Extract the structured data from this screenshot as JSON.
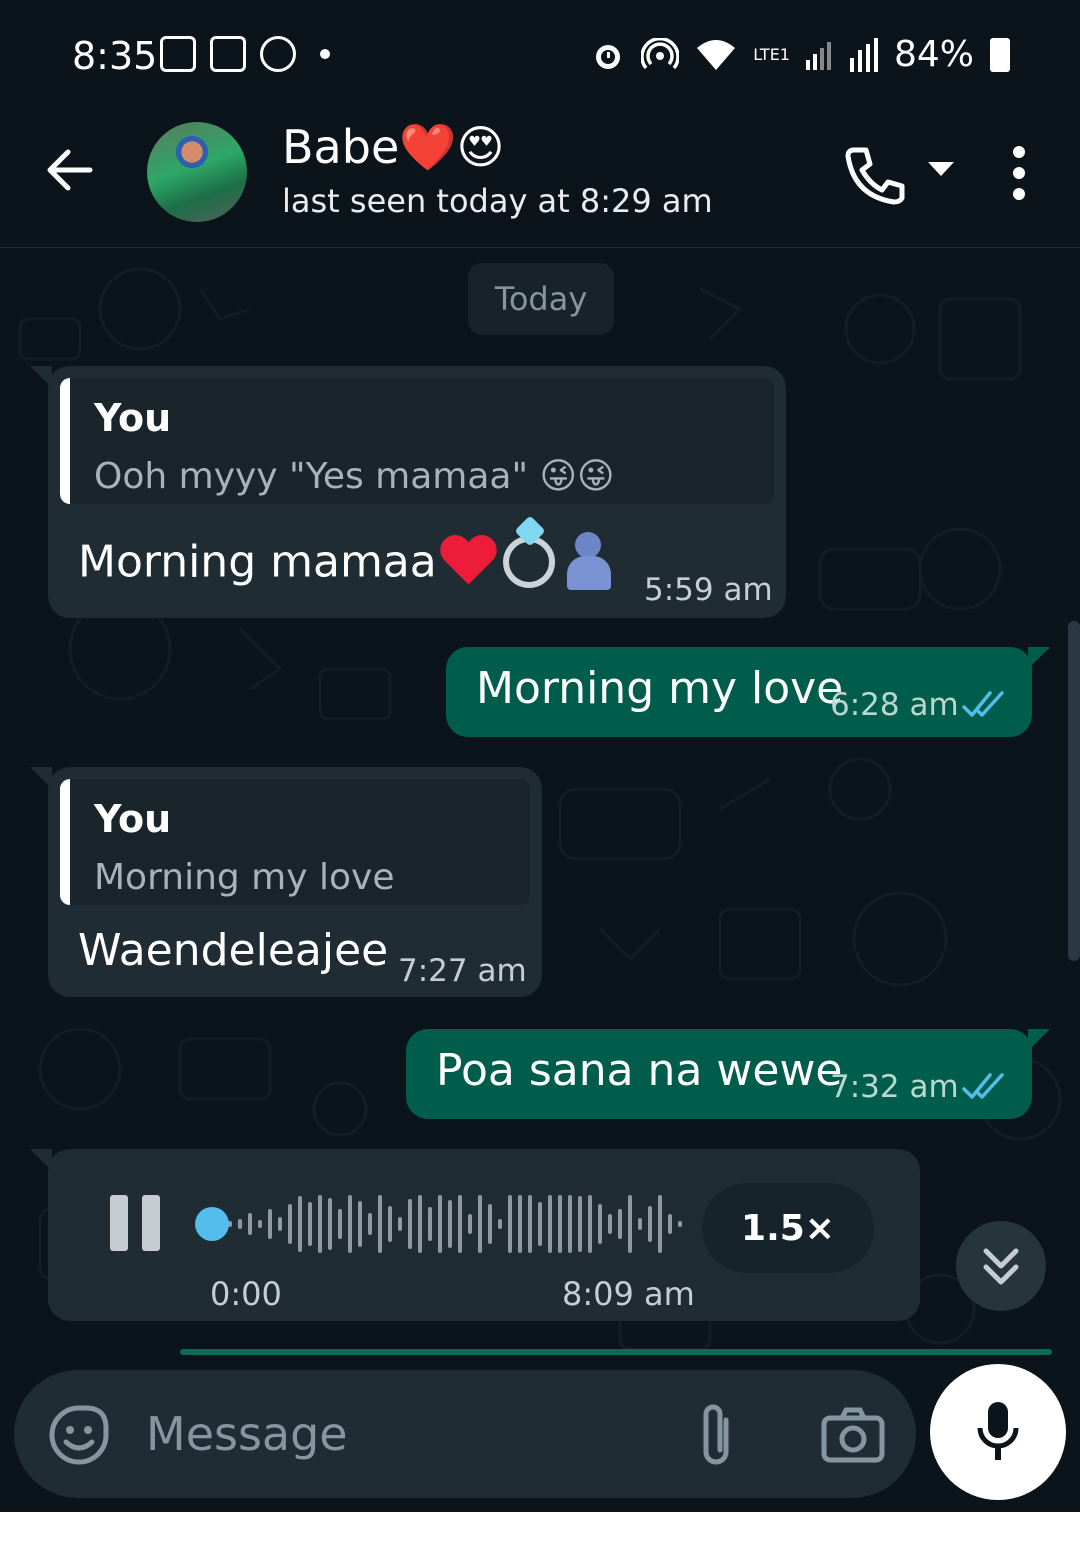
{
  "status_bar": {
    "time": "8:35",
    "battery": "84%",
    "network": "LTE1"
  },
  "header": {
    "contact_name": "Babe❤️😍",
    "last_seen": "last seen today at 8:29 am"
  },
  "date_chip": "Today",
  "messages": [
    {
      "direction": "incoming",
      "quote_author": "You",
      "quote_text": "Ooh myyy \"Yes mamaa\" 😜😜",
      "text": "Morning mamaa",
      "time": "5:59 am"
    },
    {
      "direction": "outgoing",
      "text": "Morning my love",
      "time": "6:28 am",
      "status": "read"
    },
    {
      "direction": "incoming",
      "quote_author": "You",
      "quote_text": "Morning my love",
      "text": "Waendeleajee",
      "time": "7:27 am"
    },
    {
      "direction": "outgoing",
      "text": "Poa sana na wewe",
      "time": "7:32 am",
      "status": "read"
    },
    {
      "direction": "incoming",
      "type": "voice",
      "playback_speed": "1.5×",
      "duration": "0:00",
      "time": "8:09 am",
      "progress": 0
    }
  ],
  "composer": {
    "placeholder": "Message"
  },
  "colors": {
    "incoming_bubble": "#1f2c33",
    "outgoing_bubble": "#005c4b",
    "background": "#0b141a",
    "read_ticks": "#53bdeb"
  }
}
